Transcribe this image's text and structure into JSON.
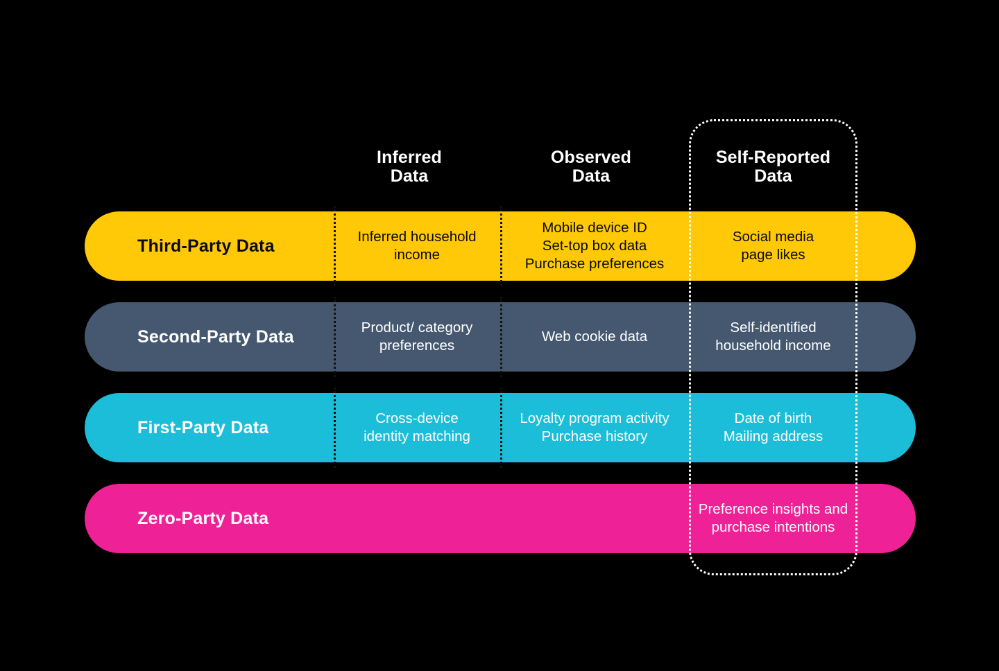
{
  "columns": [
    {
      "id": "inferred",
      "label": "Inferred\nData"
    },
    {
      "id": "observed",
      "label": "Observed\nData"
    },
    {
      "id": "self-reported",
      "label": "Self-Reported\nData"
    }
  ],
  "highlight": {
    "column": "Self-Reported Data",
    "border_color": "#ffffff",
    "style": "dotted"
  },
  "rows": [
    {
      "id": "third-party",
      "label": "Third-Party Data",
      "bar_color": "#FFC907",
      "text_color": "#0a0a0a",
      "divider_color": "#111111",
      "inferred": "Inferred household\nincome",
      "observed": "Mobile device ID\nSet-top box data\nPurchase preferences",
      "self_reported": "Social media\npage likes",
      "has_dividers": true
    },
    {
      "id": "second-party",
      "label": "Second-Party Data",
      "bar_color": "#455870",
      "text_color": "#ffffff",
      "divider_color": "#111111",
      "inferred": "Product/ category\npreferences",
      "observed": "Web cookie data",
      "self_reported": "Self-identified\nhousehold income",
      "has_dividers": true
    },
    {
      "id": "first-party",
      "label": "First-Party Data",
      "bar_color": "#1CBDD8",
      "text_color": "#ffffff",
      "divider_color": "#111111",
      "inferred": "Cross-device\nidentity matching",
      "observed": "Loyalty program activity\nPurchase history",
      "self_reported": "Date of birth\nMailing address",
      "has_dividers": true
    },
    {
      "id": "zero-party",
      "label": "Zero-Party Data",
      "bar_color": "#EE2296",
      "text_color": "#ffffff",
      "divider_color": "#111111",
      "inferred": "",
      "observed": "",
      "self_reported": "Preference insights and\npurchase intentions",
      "has_dividers": false
    }
  ],
  "background_color": "#000000"
}
